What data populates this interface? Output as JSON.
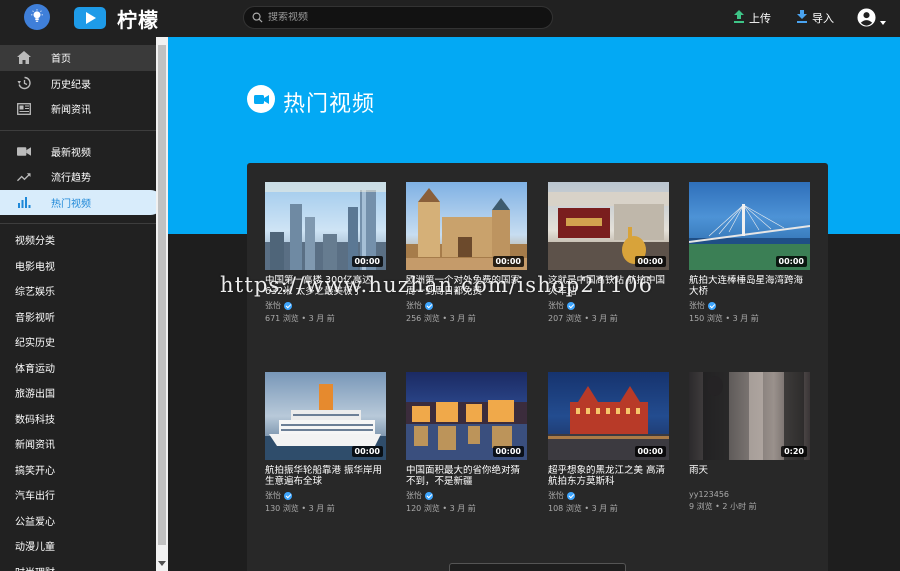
{
  "header": {
    "logo_text": "柠檬",
    "search_placeholder": "搜索视频",
    "upload_label": "上传",
    "import_label": "导入"
  },
  "sidebar": {
    "main_items": [
      {
        "label": "首页",
        "icon": "home-icon"
      },
      {
        "label": "历史纪录",
        "icon": "history-icon"
      },
      {
        "label": "新闻资讯",
        "icon": "news-icon"
      }
    ],
    "secondary_items": [
      {
        "label": "最新视频",
        "icon": "video-camera-icon"
      },
      {
        "label": "流行趋势",
        "icon": "trending-icon"
      },
      {
        "label": "热门视频",
        "icon": "bar-chart-icon"
      }
    ],
    "categories": [
      "视频分类",
      "电影电视",
      "综艺娱乐",
      "音影视听",
      "纪实历史",
      "体育运动",
      "旅游出国",
      "数码科技",
      "新闻资讯",
      "搞笑开心",
      "汽车出行",
      "公益爱心",
      "动漫儿童",
      "时尚理财"
    ]
  },
  "hero": {
    "title": "热门视频"
  },
  "videos": [
    {
      "title": "中国第一高楼 300亿高达632米 太多之最美极了",
      "author": "张怡",
      "meta": "671 浏览 • 3 月 前",
      "duration": "00:00",
      "verified": true
    },
    {
      "title": "欧洲第一个对外免费的国家 周一到周日都免费",
      "author": "张怡",
      "meta": "256 浏览 • 3 月 前",
      "duration": "00:00",
      "verified": true
    },
    {
      "title": "这就是中国高铁站 航拍中国火车站",
      "author": "张怡",
      "meta": "207 浏览 • 3 月 前",
      "duration": "00:00",
      "verified": true
    },
    {
      "title": "航拍大连棒棰岛星海湾跨海大桥",
      "author": "张怡",
      "meta": "150 浏览 • 3 月 前",
      "duration": "00:00",
      "verified": true
    },
    {
      "title": "航拍振华轮船靠港 振华岸用生意遍布全球",
      "author": "张怡",
      "meta": "130 浏览 • 3 月 前",
      "duration": "00:00",
      "verified": true
    },
    {
      "title": "中国面积最大的省你绝对猜不到，不是新疆",
      "author": "张怡",
      "meta": "120 浏览 • 3 月 前",
      "duration": "00:00",
      "verified": true
    },
    {
      "title": "超乎想象的黑龙江之美 高清航拍东方莫斯科",
      "author": "张怡",
      "meta": "108 浏览 • 3 月 前",
      "duration": "00:00",
      "verified": true
    },
    {
      "title": "雨天",
      "author": "yy123456",
      "meta": "9 浏览 • 2 小时 前",
      "duration": "0:20",
      "verified": false
    }
  ],
  "watermark": "https://www.huzhan.com/ishop21106",
  "colors": {
    "accent_blue": "#03a9f4",
    "logo_blue": "#1e9be8",
    "upload_green": "#3ec487",
    "import_blue": "#4aa3f0",
    "panel_bg": "#282828",
    "topbar_bg": "#212121"
  }
}
